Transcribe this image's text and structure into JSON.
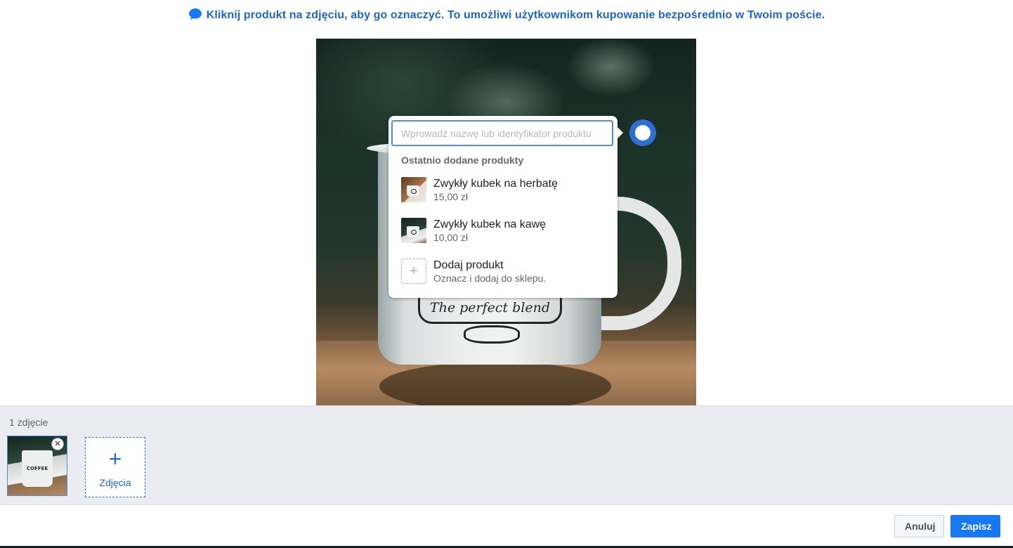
{
  "hint": {
    "text": "Kliknij produkt na zdjęciu, aby go oznaczyć. To umożliwi użytkownikom kupowanie bezpośrednio w Twoim poście.",
    "icon": "chat-bubble-icon",
    "color": "#1d66c9"
  },
  "photo": {
    "mug_text": "The perfect blend"
  },
  "popover": {
    "search_placeholder": "Wprowadź nazwę lub identyfikator produktu",
    "search_value": "",
    "section_title": "Ostatnio dodane produkty",
    "products": [
      {
        "name": "Zwykły kubek na herbatę",
        "price": "15,00 zł",
        "thumb": "tea-mug"
      },
      {
        "name": "Zwykły kubek na kawę",
        "price": "10,00 zł",
        "thumb": "coffee-mug"
      }
    ],
    "add_product": {
      "title": "Dodaj produkt",
      "subtitle": "Oznacz i dodaj do sklepu."
    }
  },
  "tray": {
    "count_label": "1 zdjęcie",
    "add_photos_label": "Zdjęcia",
    "thumb_text": "COFFEE"
  },
  "footer": {
    "cancel_label": "Anuluj",
    "save_label": "Zapisz"
  },
  "colors": {
    "accent": "#1877f2",
    "marker": "#2d6fd6",
    "tray_bg": "#ebecf0"
  }
}
